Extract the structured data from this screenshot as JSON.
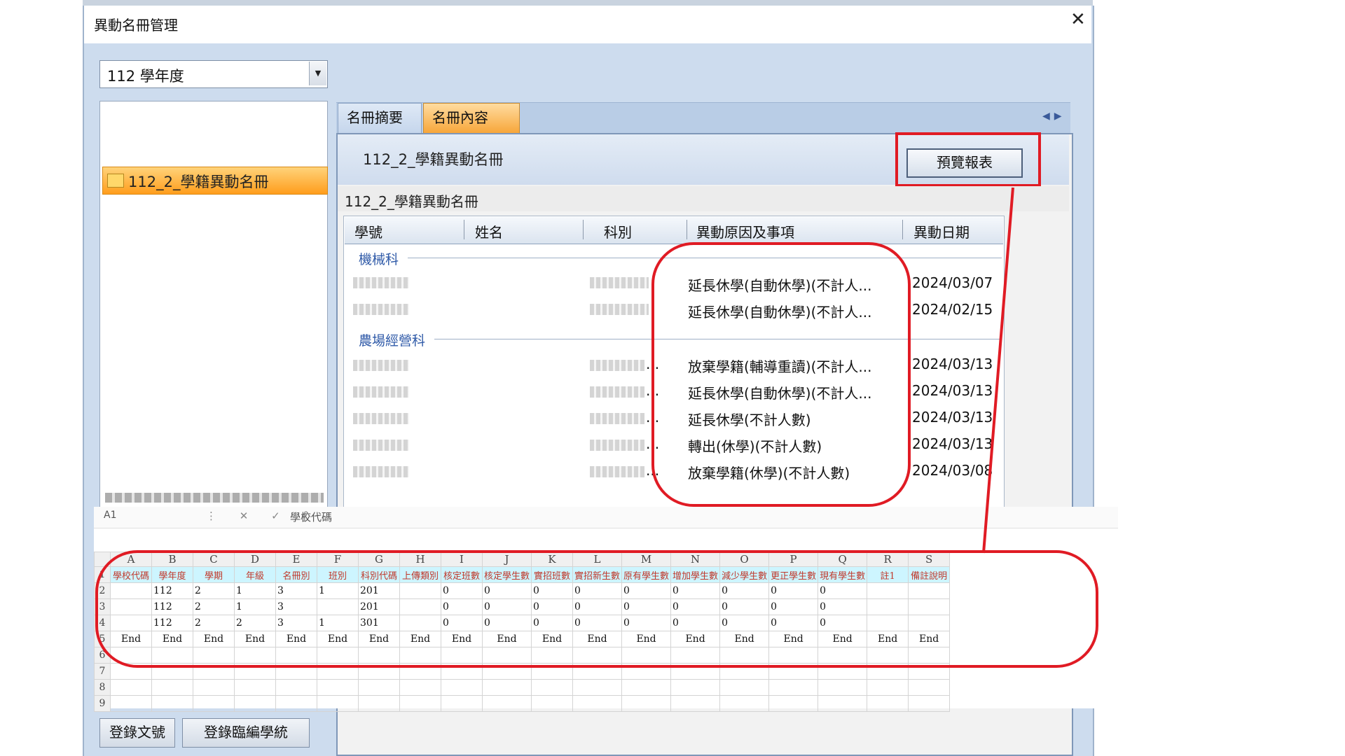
{
  "window": {
    "title": "異動名冊管理",
    "close_icon": "close-icon"
  },
  "year_select": {
    "value": "112 學年度"
  },
  "tree": {
    "selected_item": "112_2_學籍異動名冊"
  },
  "tabs": [
    {
      "label": "名冊摘要"
    },
    {
      "label": "名冊內容"
    }
  ],
  "panel": {
    "title": "112_2_學籍異動名冊",
    "preview_button": "預覽報表",
    "list_title": "112_2_學籍異動名冊"
  },
  "grid": {
    "columns": [
      "學號",
      "姓名",
      "科別",
      "異動原因及事項",
      "異動日期"
    ],
    "groups": [
      {
        "name": "機械科",
        "rows": [
          {
            "reason": "延長休學(自動休學)(不計人...",
            "date": "2024/03/07"
          },
          {
            "reason": "延長休學(自動休學)(不計人...",
            "date": "2024/02/15"
          }
        ]
      },
      {
        "name": "農場經營科",
        "rows": [
          {
            "dept": "...",
            "reason": "放棄學籍(輔導重讀)(不計人...",
            "date": "2024/03/13"
          },
          {
            "dept": "...",
            "reason": "延長休學(自動休學)(不計人...",
            "date": "2024/03/13"
          },
          {
            "dept": "...",
            "reason": "延長休學(不計人數)",
            "date": "2024/03/13"
          },
          {
            "dept": "...",
            "reason": "轉出(休學)(不計人數)",
            "date": "2024/03/13"
          },
          {
            "dept": "...",
            "reason": "放棄學籍(休學)(不計人數)",
            "date": "2024/03/08"
          }
        ]
      }
    ]
  },
  "excel": {
    "name_box": "A1",
    "formula_value": "學校代碼",
    "col_letters": [
      "A",
      "B",
      "C",
      "D",
      "E",
      "F",
      "G",
      "H",
      "I",
      "J",
      "K",
      "L",
      "M",
      "N",
      "O",
      "P",
      "Q",
      "R",
      "S"
    ],
    "row_numbers": [
      "1",
      "2",
      "3",
      "4",
      "5",
      "6",
      "7",
      "8",
      "9"
    ],
    "headers": [
      "學校代碼",
      "學年度",
      "學期",
      "年級",
      "名冊別",
      "班別",
      "科別代碼",
      "上傳類別",
      "核定班數",
      "核定學生數",
      "實招班數",
      "實招新生數",
      "原有學生數",
      "增加學生數",
      "減少學生數",
      "更正學生數",
      "現有學生數",
      "註1",
      "備註說明"
    ],
    "rows": [
      [
        "",
        "112",
        "2",
        "1",
        "3",
        "1",
        "201",
        "",
        "0",
        "0",
        "0",
        "0",
        "0",
        "0",
        "0",
        "0",
        "0",
        "",
        ""
      ],
      [
        "",
        "112",
        "2",
        "1",
        "3",
        "",
        "201",
        "",
        "0",
        "0",
        "0",
        "0",
        "0",
        "0",
        "0",
        "0",
        "0",
        "",
        ""
      ],
      [
        "",
        "112",
        "2",
        "2",
        "3",
        "1",
        "301",
        "",
        "0",
        "0",
        "0",
        "0",
        "0",
        "0",
        "0",
        "0",
        "0",
        "",
        ""
      ]
    ],
    "end_label": "End"
  },
  "buttons": {
    "register_doc": "登錄文號",
    "register_temp": "登錄臨編學統"
  }
}
